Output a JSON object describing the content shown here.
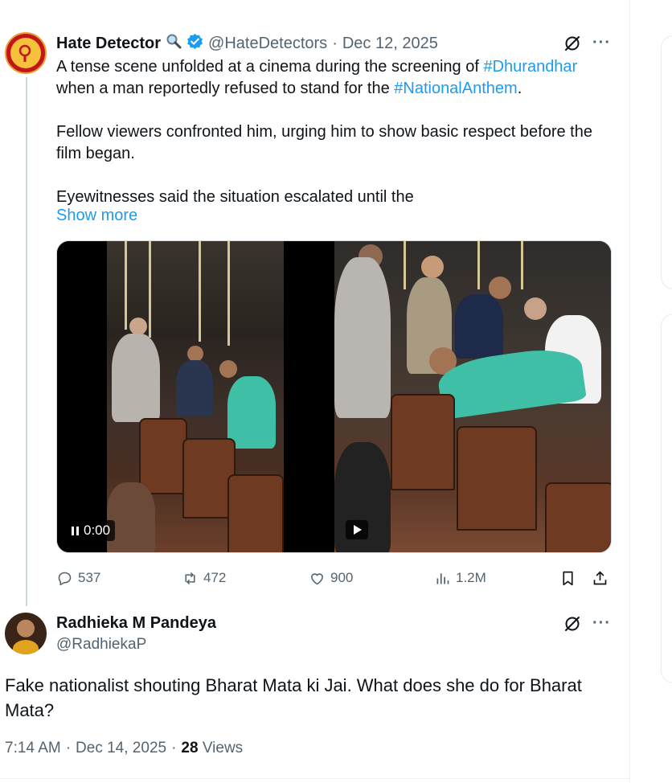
{
  "tweet": {
    "author_name": "Hate Detector",
    "handle": "@HateDetectors",
    "separator": "·",
    "date": "Dec 12, 2025",
    "text_p1_a": "A tense scene unfolded at a cinema during the screening of ",
    "hashtag_1": "#Dhurandhar",
    "text_p1_b": " when a man reportedly refused to stand for the ",
    "hashtag_2": "#NationalAnthem",
    "text_p1_c": ".",
    "text_p2": "Fellow viewers confronted him, urging him to show basic respect before the film began.",
    "text_p3": "Eyewitnesses said the situation escalated until the",
    "show_more": "Show more",
    "video_time": "0:00",
    "stats": {
      "replies": "537",
      "reposts": "472",
      "likes": "900",
      "views": "1.2M"
    }
  },
  "reply": {
    "author_name": "Radhieka M Pandeya",
    "handle": "@RadhiekaP",
    "text": "Fake nationalist shouting Bharat Mata ki Jai. What does she do for Bharat Mata?",
    "time": "7:14 AM",
    "separator": "·",
    "date": "Dec 14, 2025",
    "separator2": "·",
    "views_count": "28",
    "views_label": "Views"
  },
  "icons": {
    "search": "magnifier-emoji-icon",
    "verified": "verified-badge-icon",
    "grok": "grok-icon",
    "more": "more-icon",
    "reply": "reply-icon",
    "repost": "repost-icon",
    "like": "like-icon",
    "views": "views-icon",
    "bookmark": "bookmark-icon",
    "share": "share-icon"
  },
  "colors": {
    "link": "#1d9bf0",
    "muted": "#536471",
    "text": "#0f1419",
    "verified": "#1d9bf0"
  }
}
